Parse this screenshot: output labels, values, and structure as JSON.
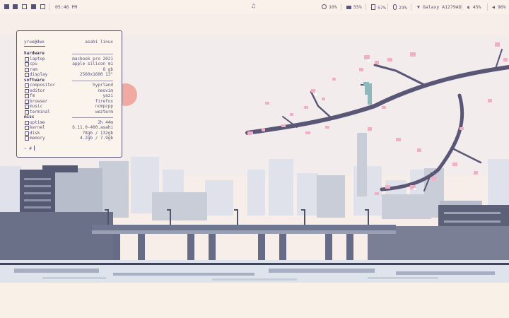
{
  "topbar": {
    "workspaces": [
      "filled",
      "empty",
      "empty",
      "filled",
      "empty"
    ],
    "clock": "05:46 PM",
    "media_icon": "music-note-icon",
    "cpu": "10%",
    "ram": "55%",
    "battery": "57%",
    "temp": "23%",
    "wifi": "Galaxy A1279AD",
    "brightness": "45%",
    "volume": "96%"
  },
  "terminal": {
    "user": "yrue@dwx",
    "os": "asahi linux",
    "sections": [
      {
        "title": "hardware",
        "rows": [
          {
            "k": "laptop",
            "v": "macbook pro 2021"
          },
          {
            "k": "cpu",
            "v": "apple silicon m1"
          },
          {
            "k": "ram",
            "v": "8 gb"
          },
          {
            "k": "display",
            "v": "2560x1600 13\""
          }
        ]
      },
      {
        "title": "software",
        "rows": [
          {
            "k": "compositor",
            "v": "hyprland"
          },
          {
            "k": "editor",
            "v": "neovim"
          },
          {
            "k": "fm",
            "v": "yazi"
          },
          {
            "k": "browser",
            "v": "firefox"
          },
          {
            "k": "music",
            "v": "ncmpcpp"
          },
          {
            "k": "terminal",
            "v": "wezterm"
          }
        ]
      },
      {
        "title": "misc",
        "rows": [
          {
            "k": "uptime",
            "v": "2h 44m"
          },
          {
            "k": "kernel",
            "v": "6.11.0-400.asahi"
          },
          {
            "k": "disk",
            "v": "78gb / 132gb"
          },
          {
            "k": "memory",
            "v": "4.2gb / 7.9gb"
          }
        ]
      }
    ],
    "prompt": "~ #"
  },
  "colors": {
    "bg": "#f9f0e8",
    "ink": "#575270",
    "sun": "#f0a8a0",
    "blossom": "#eeb0c4",
    "branch": "#5a5676",
    "building": "#c6cbd6",
    "bridge": "#767d96",
    "bird": "#8fb8bc"
  }
}
